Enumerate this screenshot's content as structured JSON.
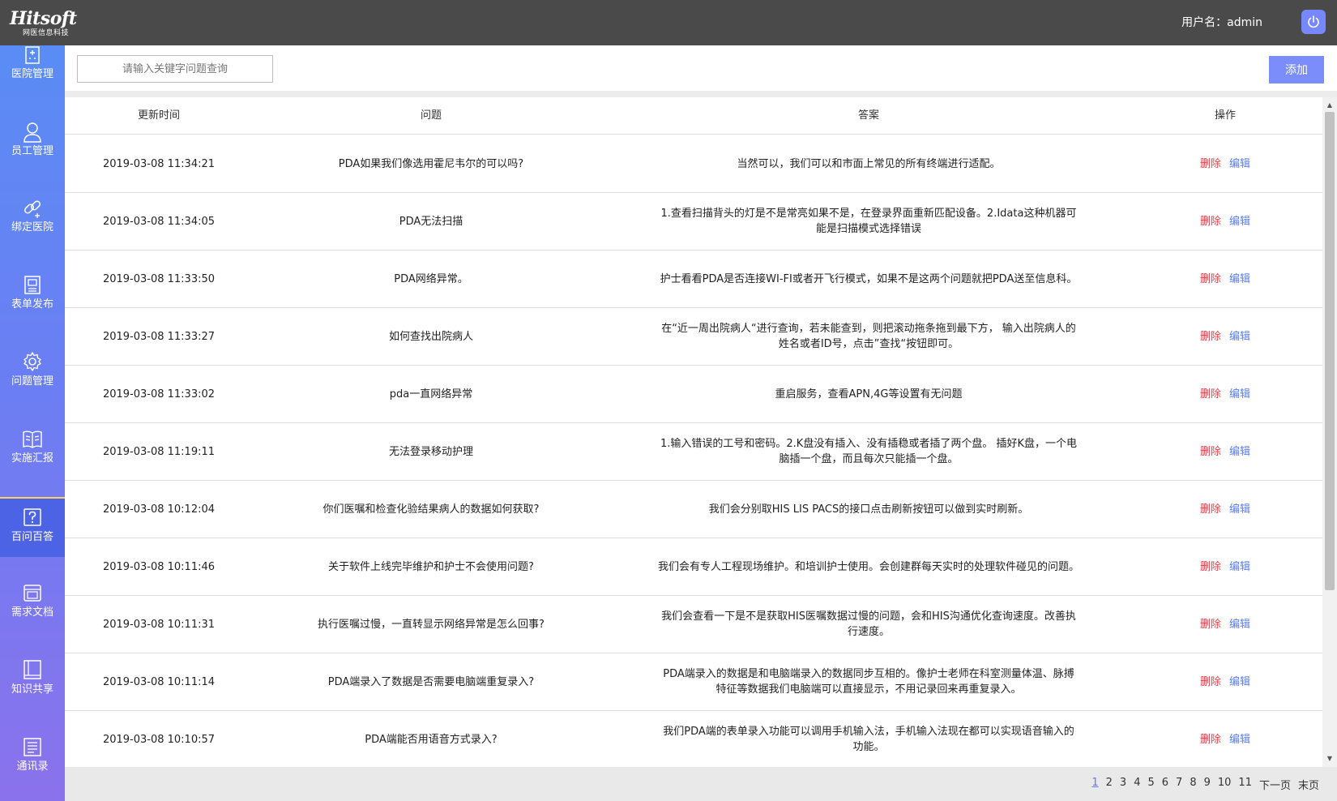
{
  "header": {
    "logo_text": "Hitsoft",
    "logo_subtext": "网医信息科技",
    "user_label": "用户名：",
    "username": "admin"
  },
  "sidebar": {
    "items": [
      {
        "label": "医院管理",
        "icon": "hospital-icon"
      },
      {
        "label": "员工管理",
        "icon": "user-icon"
      },
      {
        "label": "绑定医院",
        "icon": "link-icon"
      },
      {
        "label": "表单发布",
        "icon": "form-icon"
      },
      {
        "label": "问题管理",
        "icon": "gear-icon"
      },
      {
        "label": "实施汇报",
        "icon": "book-icon"
      },
      {
        "label": "百问百答",
        "icon": "question-icon",
        "active": true
      },
      {
        "label": "需求文档",
        "icon": "document-icon"
      },
      {
        "label": "知识共享",
        "icon": "knowledge-book-icon"
      },
      {
        "label": "通讯录",
        "icon": "contacts-icon"
      }
    ]
  },
  "search": {
    "placeholder": "请输入关键字问题查询",
    "value": ""
  },
  "toolbar": {
    "add_label": "添加"
  },
  "table": {
    "headers": [
      "更新时间",
      "问题",
      "答案",
      "操作"
    ],
    "delete_label": "删除",
    "edit_label": "编辑",
    "rows": [
      {
        "time": "2019-03-08 11:34:21",
        "question": "PDA如果我们像选用霍尼韦尔的可以吗?",
        "answer": "当然可以，我们可以和市面上常见的所有终端进行适配。"
      },
      {
        "time": "2019-03-08 11:34:05",
        "question": "PDA无法扫描",
        "answer": "1.查看扫描背头的灯是不是常亮如果不是，在登录界面重新匹配设备。2.Idata这种机器可能是扫描模式选择错误"
      },
      {
        "time": "2019-03-08 11:33:50",
        "question": "PDA网络异常。",
        "answer": "护士看看PDA是否连接WI-FI或者开飞行模式，如果不是这两个问题就把PDA送至信息科。"
      },
      {
        "time": "2019-03-08 11:33:27",
        "question": "如何查找出院病人",
        "answer": "在“近一周出院病人“进行查询，若未能查到，则把滚动拖条拖到最下方， 输入出院病人的姓名或者ID号，点击”查找“按钮即可。"
      },
      {
        "time": "2019-03-08 11:33:02",
        "question": "pda一直网络异常",
        "answer": "重启服务，查看APN,4G等设置有无问题"
      },
      {
        "time": "2019-03-08 11:19:11",
        "question": "无法登录移动护理",
        "answer": "1.输入错误的工号和密码。2.K盘没有插入、没有插稳或者插了两个盘。 插好K盘，一个电脑插一个盘，而且每次只能插一个盘。"
      },
      {
        "time": "2019-03-08 10:12:04",
        "question": "你们医嘱和检查化验结果病人的数据如何获取?",
        "answer": "我们会分别取HIS LIS PACS的接口点击刷新按钮可以做到实时刷新。"
      },
      {
        "time": "2019-03-08 10:11:46",
        "question": "关于软件上线完毕维护和护士不会使用问题?",
        "answer": "我们会有专人工程现场维护。和培训护士使用。会创建群每天实时的处理软件碰见的问题。"
      },
      {
        "time": "2019-03-08 10:11:31",
        "question": "执行医嘱过慢，一直转显示网络异常是怎么回事?",
        "answer": "我们会查看一下是不是获取HIS医嘱数据过慢的问题，会和HIS沟通优化查询速度。改善执行速度。"
      },
      {
        "time": "2019-03-08 10:11:14",
        "question": "PDA端录入了数据是否需要电脑端重复录入?",
        "answer": "PDA端录入的数据是和电脑端录入的数据同步互相的。像护士老师在科室测量体温、脉搏特征等数据我们电脑端可以直接显示，不用记录回来再重复录入。"
      },
      {
        "time": "2019-03-08 10:10:57",
        "question": "PDA端能否用语音方式录入?",
        "answer": "我们PDA端的表单录入功能可以调用手机输入法，手机输入法现在都可以实现语音输入的功能。"
      }
    ]
  },
  "pagination": {
    "pages": [
      "1",
      "2",
      "3",
      "4",
      "5",
      "6",
      "7",
      "8",
      "9",
      "10",
      "11"
    ],
    "current": "1",
    "next_label": "下一页",
    "last_label": "末页"
  }
}
